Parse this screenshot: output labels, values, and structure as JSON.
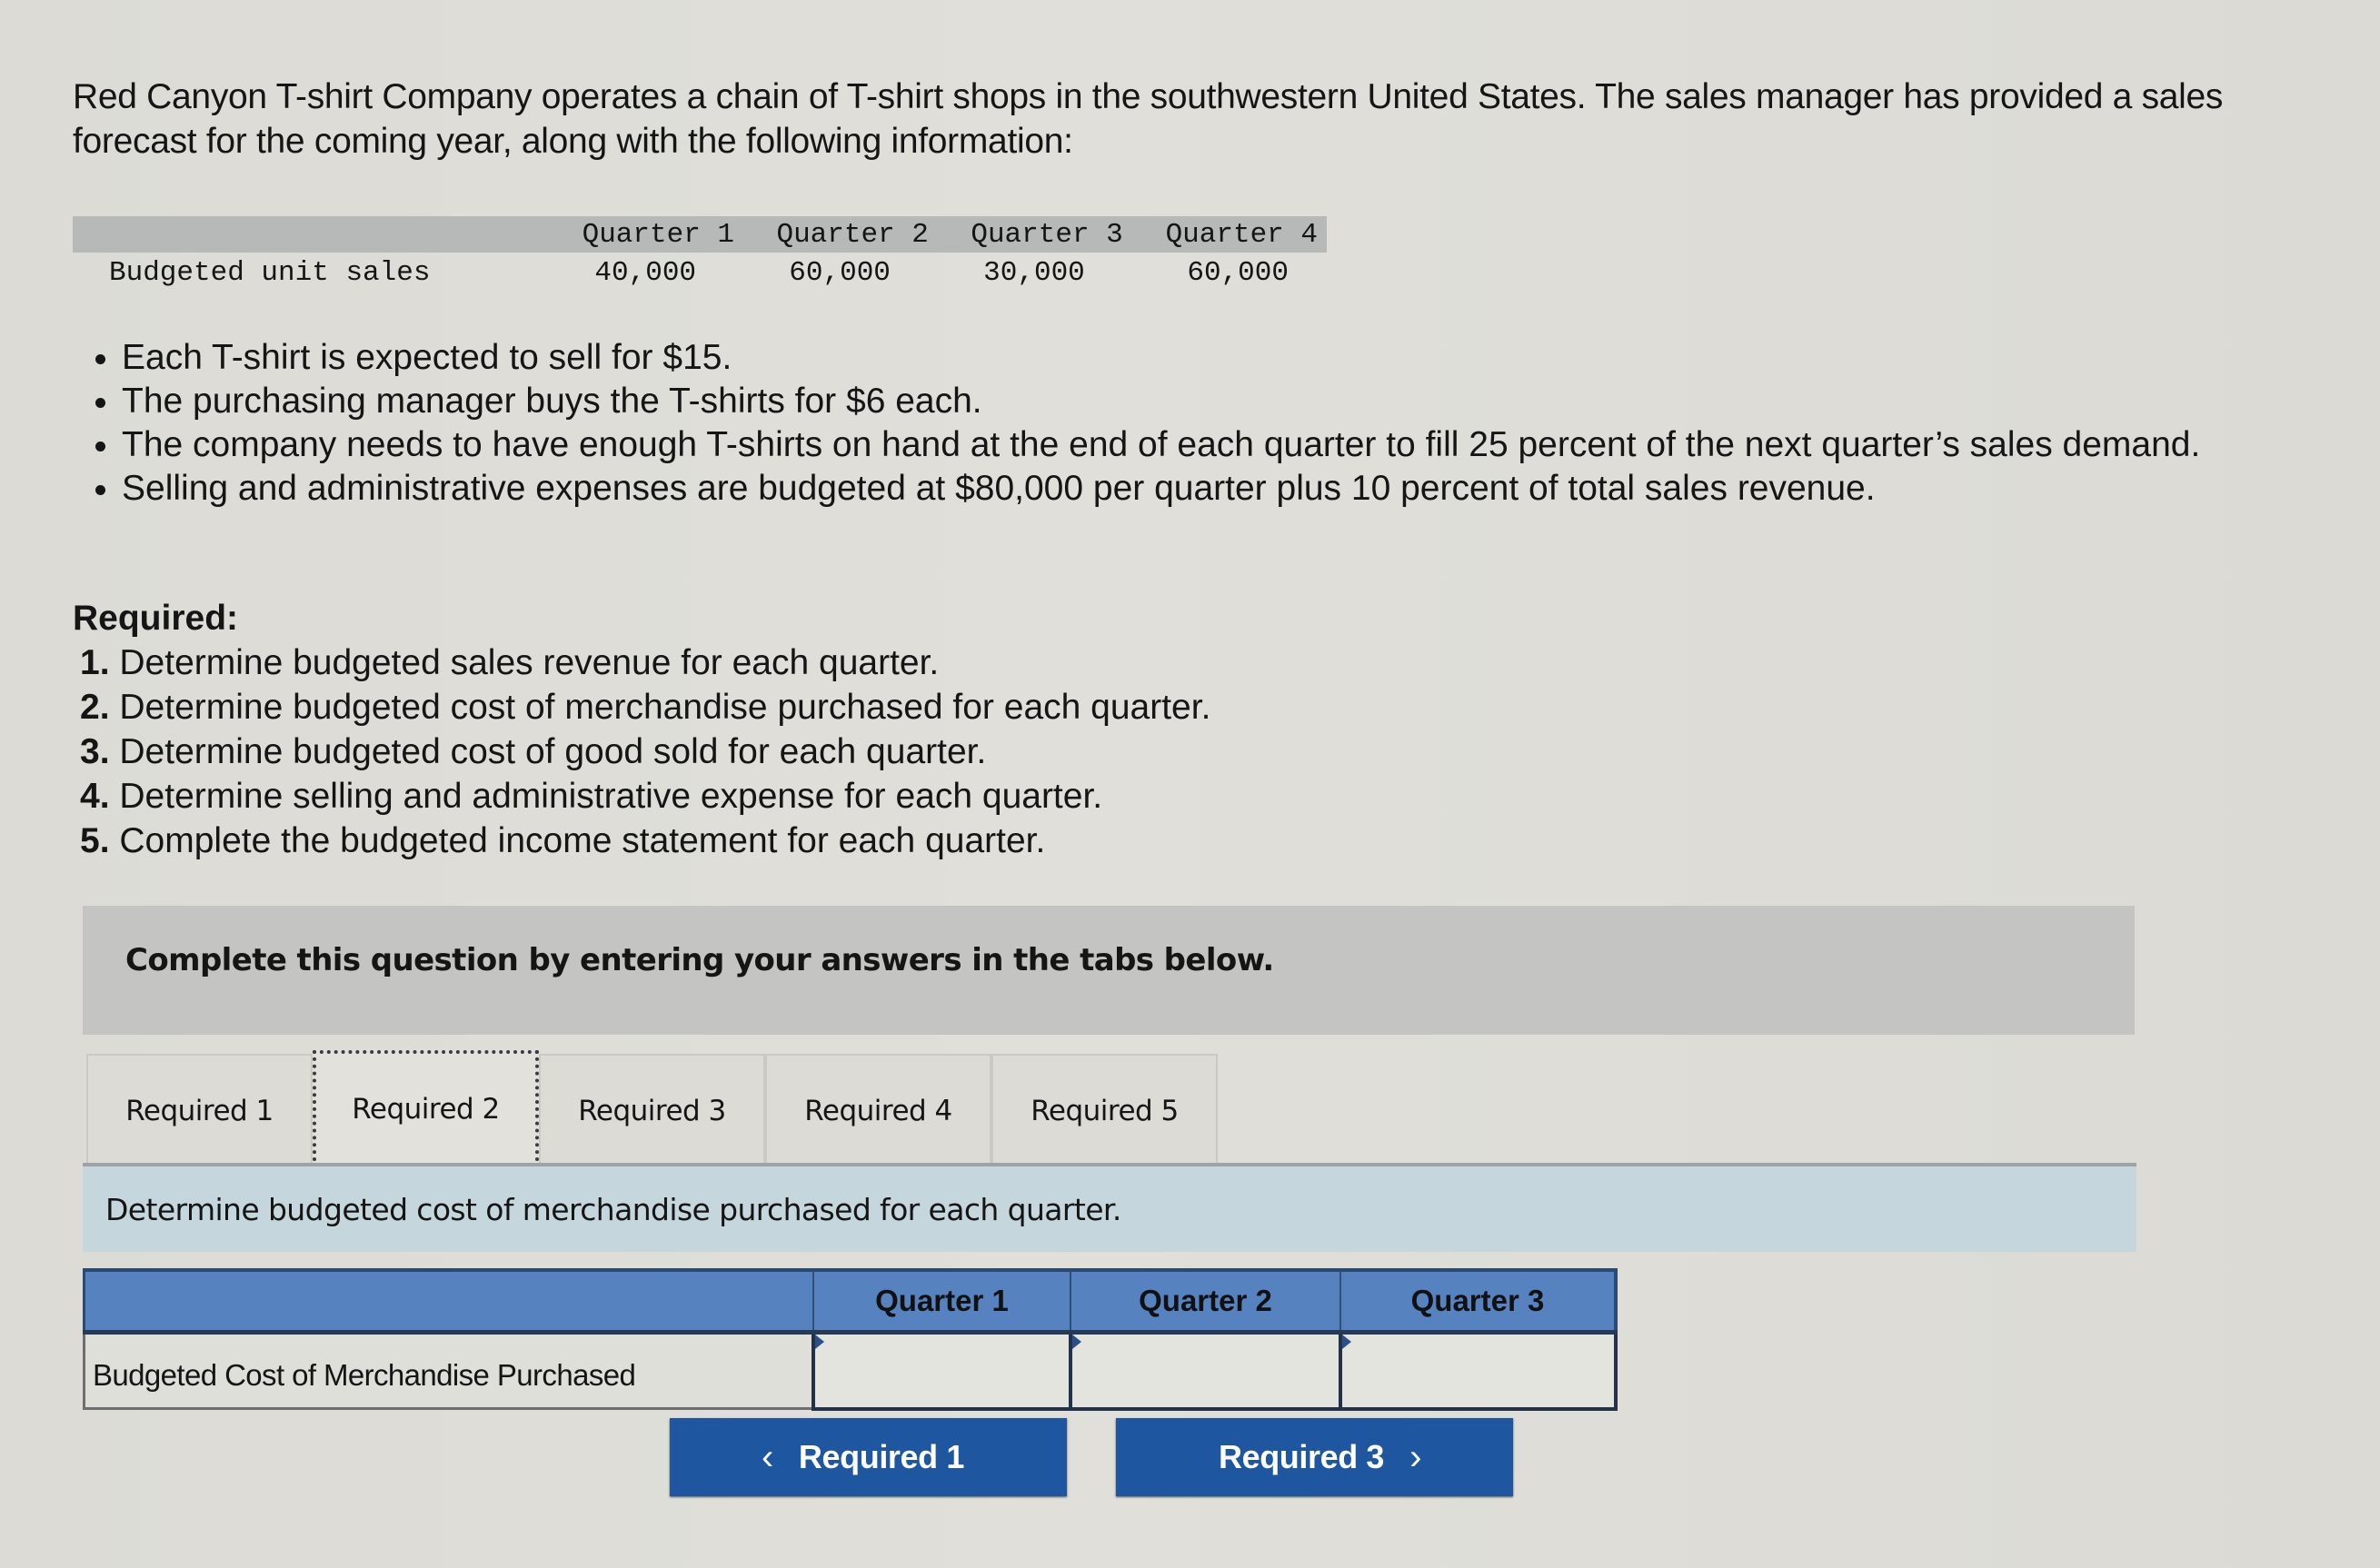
{
  "intro": "Red Canyon T-shirt Company operates a chain of T-shirt shops in the southwestern United States. The sales manager has provided a sales forecast for the coming year, along with the following information:",
  "unit_sales_table": {
    "headers": [
      "Quarter 1",
      "Quarter 2",
      "Quarter 3",
      "Quarter 4"
    ],
    "row_label": "Budgeted unit sales",
    "values": [
      "40,000",
      "60,000",
      "30,000",
      "60,000"
    ]
  },
  "bullets": [
    "Each T-shirt is expected to sell for $15.",
    "The purchasing manager buys the T-shirts for $6 each.",
    "The company needs to have enough T-shirts on hand at the end of each quarter to fill 25 percent of the next quarter’s sales demand.",
    "Selling and administrative expenses are budgeted at $80,000 per quarter plus 10 percent of total sales revenue."
  ],
  "required": {
    "heading": "Required:",
    "items": [
      {
        "num": "1.",
        "text": "Determine budgeted sales revenue for each quarter."
      },
      {
        "num": "2.",
        "text": "Determine budgeted cost of merchandise purchased for each quarter."
      },
      {
        "num": "3.",
        "text": "Determine budgeted cost of good sold for each quarter."
      },
      {
        "num": "4.",
        "text": "Determine selling and administrative expense for each quarter."
      },
      {
        "num": "5.",
        "text": "Complete the budgeted income statement for each quarter."
      }
    ]
  },
  "banner": "Complete this question by entering your answers in the tabs below.",
  "tabs": [
    {
      "label": "Required 1",
      "active": false
    },
    {
      "label": "Required 2",
      "active": true
    },
    {
      "label": "Required 3",
      "active": false
    },
    {
      "label": "Required 4",
      "active": false
    },
    {
      "label": "Required 5",
      "active": false
    }
  ],
  "instruction": "Determine budgeted cost of merchandise purchased for each quarter.",
  "answer_table": {
    "headers": [
      "",
      "Quarter 1",
      "Quarter 2",
      "Quarter 3"
    ],
    "row_label": "Budgeted Cost of Merchandise Purchased",
    "values": [
      "",
      "",
      ""
    ]
  },
  "nav": {
    "prev_label": "Required 1",
    "next_label": "Required 3",
    "prev_icon": "chevron-left-icon",
    "next_icon": "chevron-right-icon",
    "button_color": "#1e56a0"
  },
  "colors": {
    "table_header": "#5683bf",
    "instruction_bg": "#c5d6dc",
    "banner_bg": "#c4c5c2"
  }
}
